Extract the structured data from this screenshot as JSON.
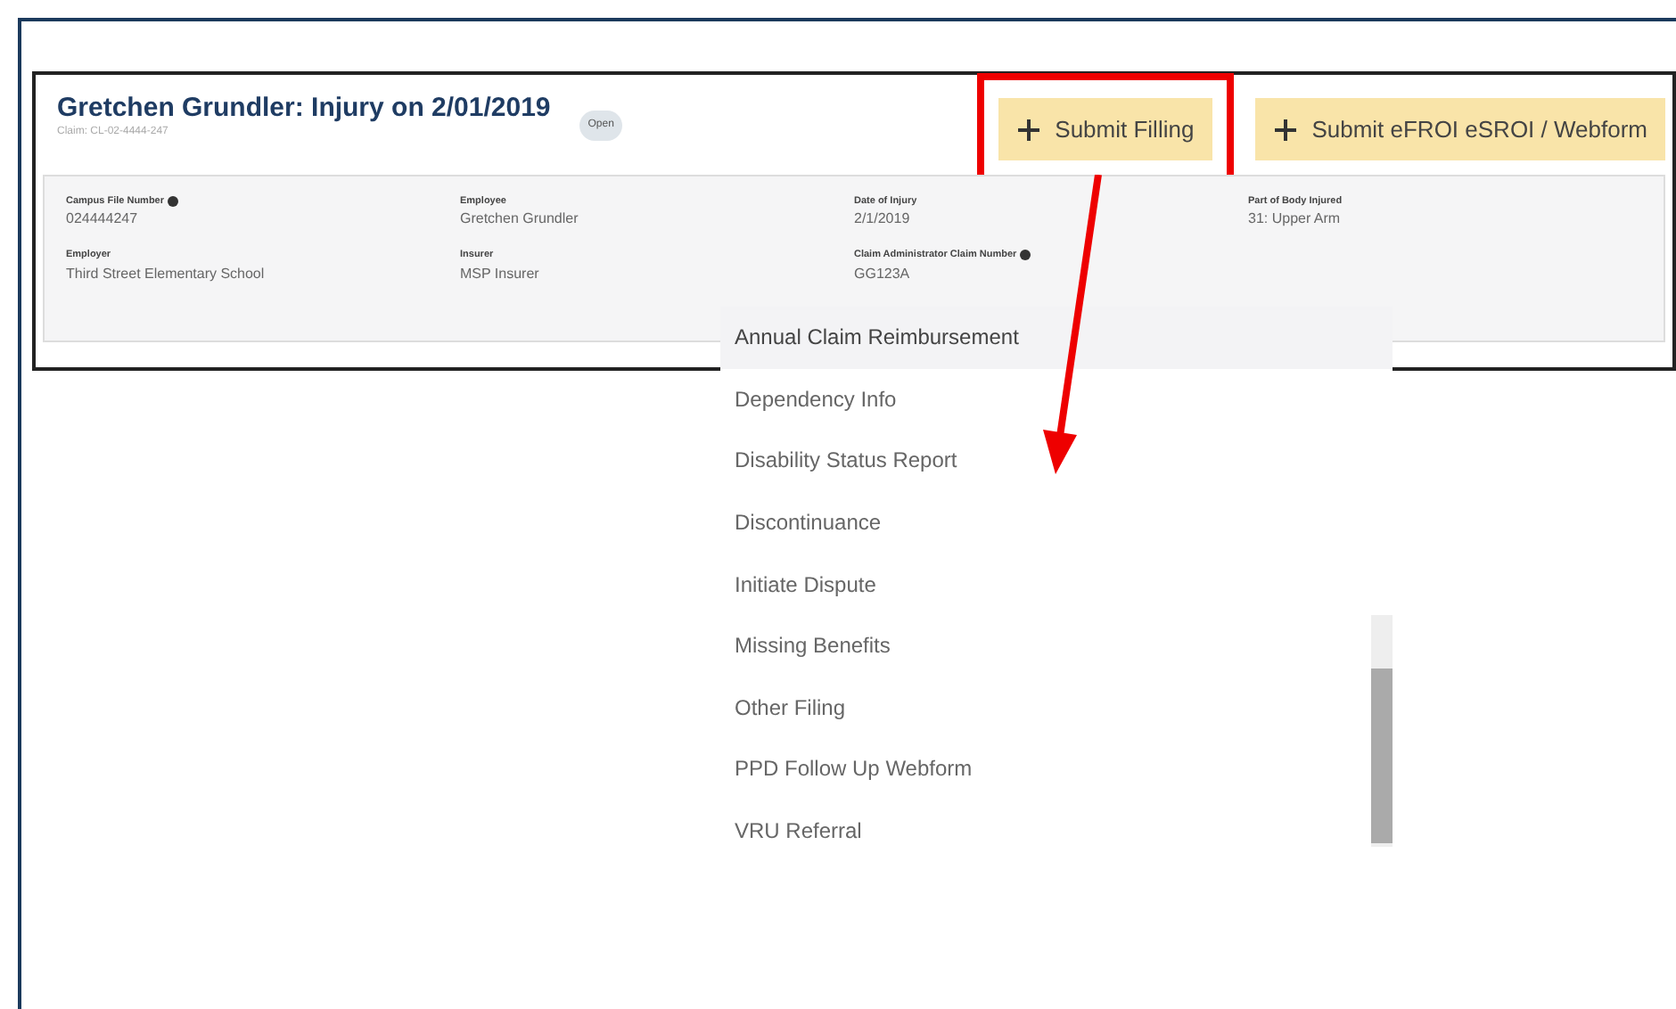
{
  "claim": {
    "title": "Gretchen Grundler: Injury on 2/01/2019",
    "claim_number": "Claim: CL-02-4444-247",
    "status": "Open"
  },
  "actions": [
    {
      "label": "Submit Filling",
      "highlighted": true
    },
    {
      "label": "Submit eFROI eSROI / Webform",
      "highlighted": false
    }
  ],
  "fields": [
    {
      "label": "Campus File Number",
      "value": "024444247",
      "info": true
    },
    {
      "label": "Employee",
      "value": "Gretchen  Grundler",
      "info": false
    },
    {
      "label": "Date of Injury",
      "value": "2/1/2019",
      "info": false
    },
    {
      "label": "Part of Body Injured",
      "value": "31: Upper Arm",
      "info": false
    },
    {
      "label": "Employer",
      "value": "Third Street Elementary School",
      "info": false
    },
    {
      "label": "Insurer",
      "value": "MSP Insurer",
      "info": false
    },
    {
      "label": "Claim Administrator Claim Number",
      "value": "GG123A",
      "info": true
    }
  ],
  "filing_menu": [
    {
      "label": "Annual Claim Reimbursement",
      "selected": true
    },
    {
      "label": "Dependency Info",
      "selected": false
    },
    {
      "label": "Disability Status Report",
      "selected": false
    },
    {
      "label": "Discontinuance",
      "selected": false
    },
    {
      "label": "Initiate Dispute",
      "selected": false
    },
    {
      "label": "Missing Benefits",
      "selected": false
    },
    {
      "label": "Other Filing",
      "selected": false
    },
    {
      "label": "PPD Follow Up Webform",
      "selected": false
    },
    {
      "label": "VRU Referral",
      "selected": false
    }
  ]
}
